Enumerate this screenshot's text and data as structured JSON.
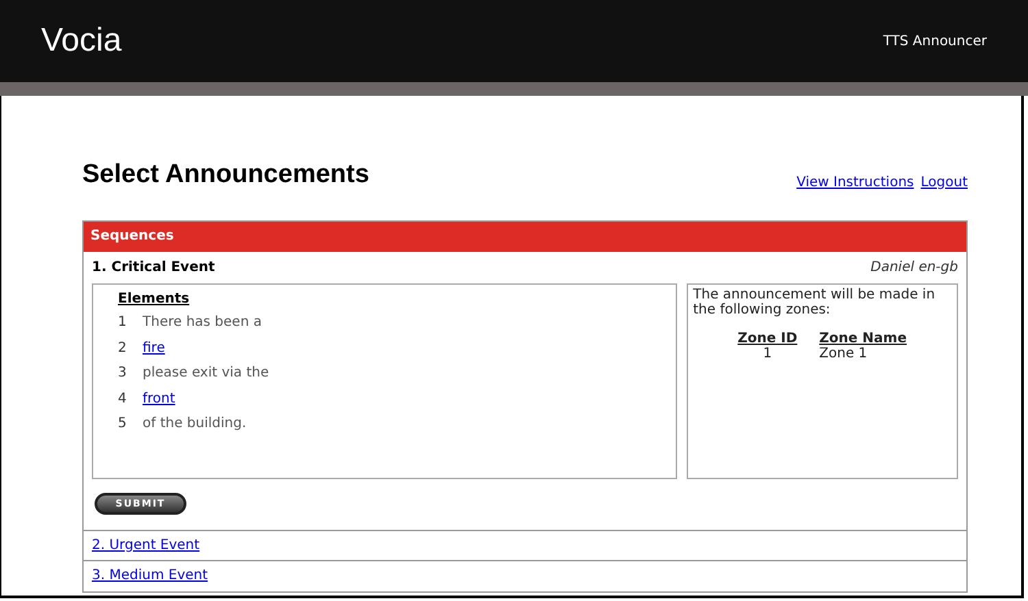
{
  "header": {
    "logo": "Vocia",
    "app_name": "TTS Announcer"
  },
  "page": {
    "title": "Select Announcements",
    "links": [
      "View Instructions",
      "Logout"
    ]
  },
  "panel": {
    "title": "Sequences",
    "sequences": [
      {
        "label": "1. Critical Event",
        "expanded": true,
        "voice": "Daniel en-gb",
        "elements_heading": "Elements",
        "elements": [
          {
            "number": "1",
            "text": "There has been a",
            "kind": "text"
          },
          {
            "number": "2",
            "text": "fire",
            "kind": "link"
          },
          {
            "number": "3",
            "text": "please exit via the",
            "kind": "text"
          },
          {
            "number": "4",
            "text": "front",
            "kind": "link"
          },
          {
            "number": "5",
            "text": "of the building.",
            "kind": "text"
          }
        ],
        "zones_intro": "The announcement will be made in the following zones:",
        "zone_columns": [
          "Zone ID",
          "Zone Name"
        ],
        "zones": [
          [
            "1",
            "Zone 1"
          ]
        ],
        "submit": "SUBMIT"
      },
      {
        "label": "2. Urgent Event",
        "expanded": false
      },
      {
        "label": "3. Medium Event",
        "expanded": false
      }
    ]
  }
}
